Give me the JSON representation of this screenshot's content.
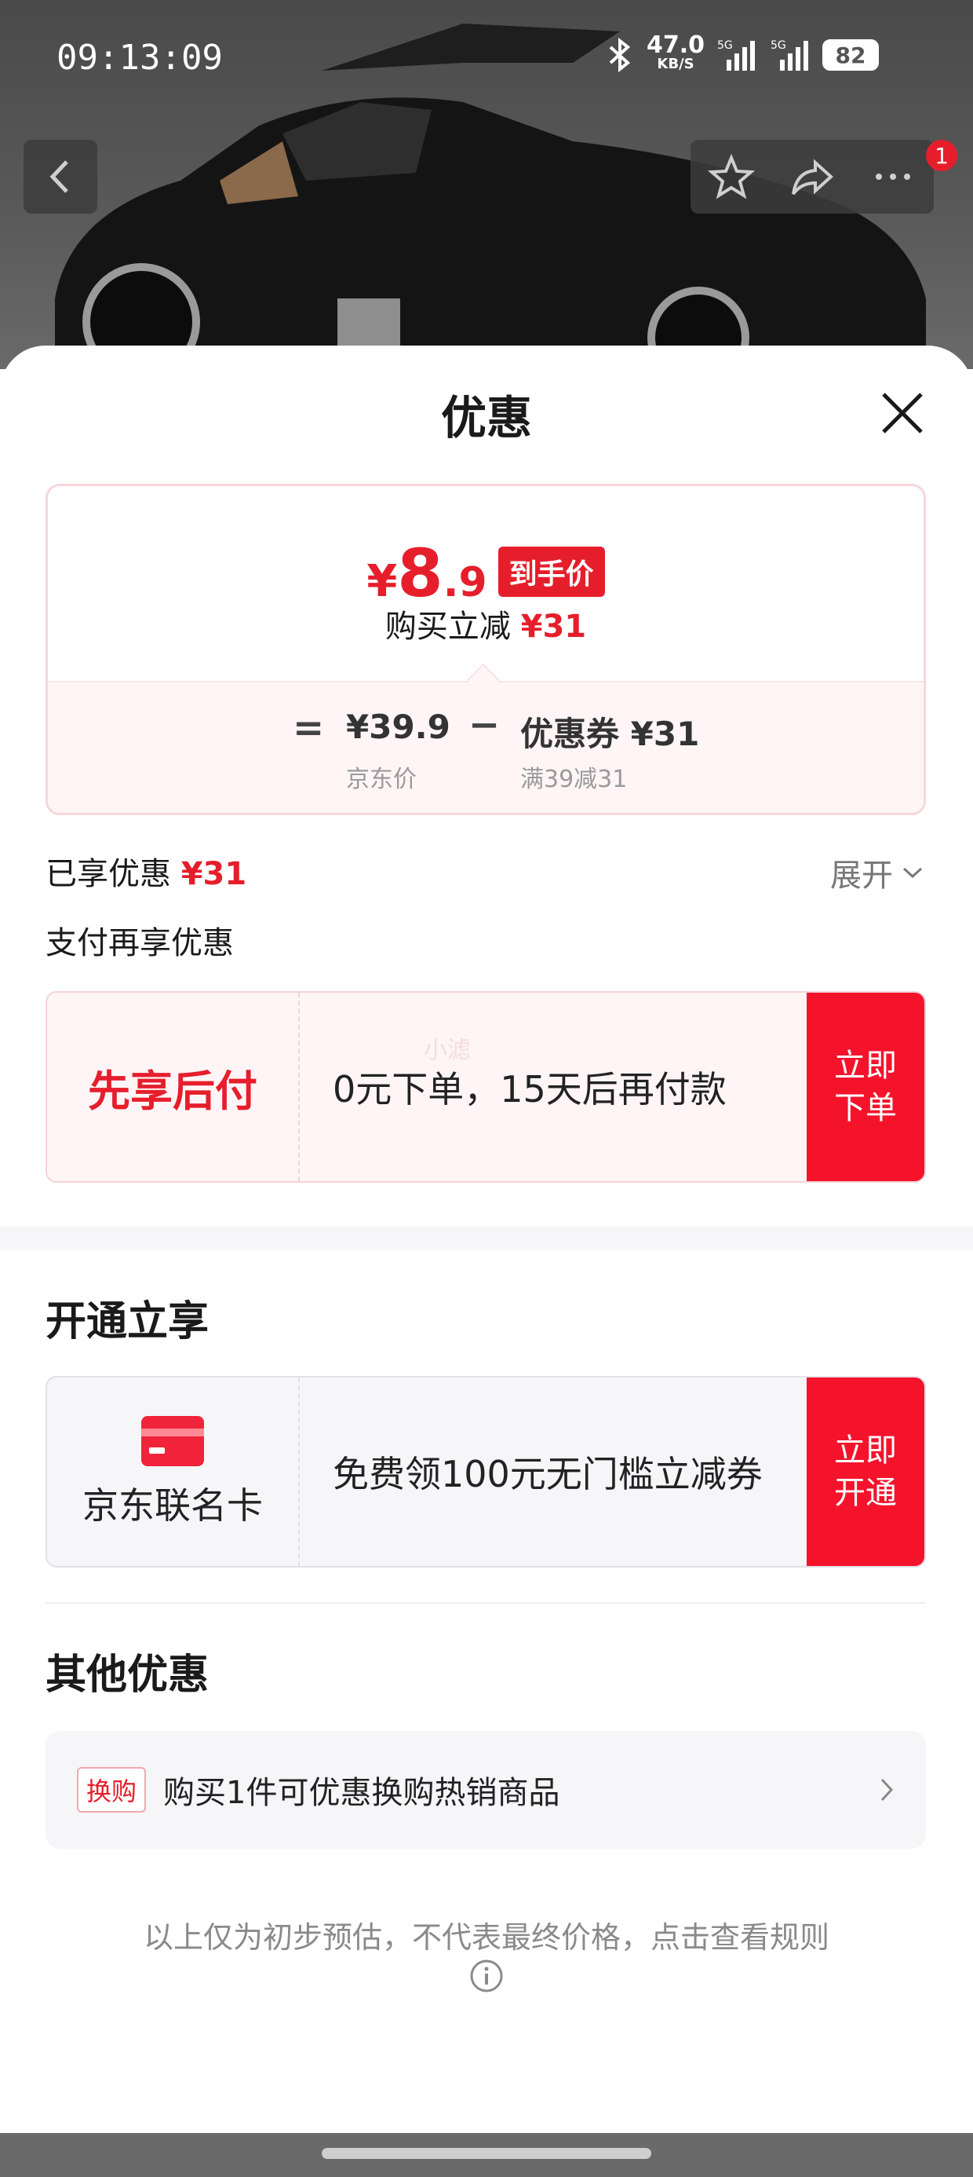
{
  "status_bar": {
    "time": "09:13:09",
    "net_speed": "47.0",
    "net_unit": "KB/S",
    "signal1": "5G",
    "signal2": "5G",
    "battery": "82"
  },
  "header": {
    "back_icon": "chevron-left-icon",
    "actions": [
      "star-icon",
      "share-icon",
      "more-icon"
    ],
    "badge_count": "1"
  },
  "sheet": {
    "title": "优惠",
    "close_icon": "close-icon"
  },
  "price_card": {
    "symbol": "¥",
    "price_int": "8",
    "price_dec": ".9",
    "tag": "到手价",
    "save_label": "购买立减",
    "save_amount": "¥31",
    "calc": {
      "equals": "=",
      "jd_price": "¥39.9",
      "jd_price_label": "京东价",
      "minus": "−",
      "coupon": "优惠券 ¥31",
      "coupon_desc": "满39减31"
    }
  },
  "enjoyed": {
    "label": "已享优惠",
    "amount": "¥31",
    "expand": "展开"
  },
  "pay_section": {
    "title": "支付再享优惠",
    "card_label": "先享后付",
    "card_text": "0元下单，15天后再付款",
    "button_line1": "立即",
    "button_line2": "下单",
    "watermark": "小滤"
  },
  "open_section": {
    "title": "开通立享",
    "card_label": "京东联名卡",
    "card_text": "免费领100元无门槛立减券",
    "button_line1": "立即",
    "button_line2": "开通"
  },
  "other_section": {
    "title": "其他优惠",
    "tag": "换购",
    "text": "购买1件可优惠换购热销商品"
  },
  "disclaimer": "以上仅为初步预估，不代表最终价格，点击查看规则",
  "colors": {
    "accent": "#e61e2c",
    "button": "#f5132c"
  }
}
